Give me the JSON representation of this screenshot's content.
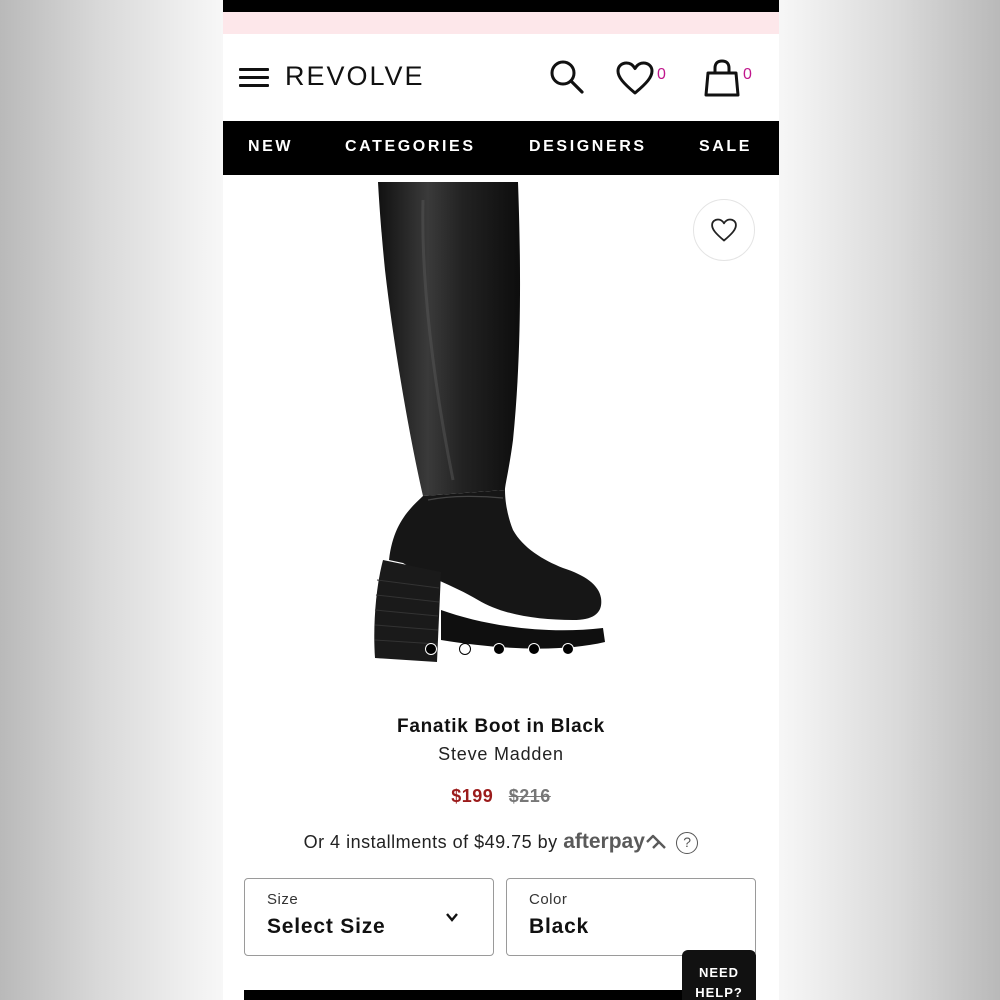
{
  "header": {
    "logo": "REVOLVE",
    "wishlist_count": "0",
    "bag_count": "0"
  },
  "nav": {
    "items": [
      "NEW",
      "CATEGORIES",
      "DESIGNERS",
      "SALE"
    ]
  },
  "product": {
    "title": "Fanatik Boot in Black",
    "brand": "Steve Madden",
    "sale_price": "$199",
    "original_price": "$216",
    "installments_text": "Or 4 installments of $49.75 by",
    "afterpay_label": "afterpay",
    "image_count": 5,
    "active_image_index": 0
  },
  "selectors": {
    "size": {
      "label": "Size",
      "value": "Select Size"
    },
    "color": {
      "label": "Color",
      "value": "Black"
    }
  },
  "help": {
    "line1": "NEED",
    "line2": "HELP?"
  },
  "colors": {
    "accent_pink": "#c0168c",
    "sale_red": "#9b1b1b",
    "promo_bg": "#fde7ea"
  }
}
